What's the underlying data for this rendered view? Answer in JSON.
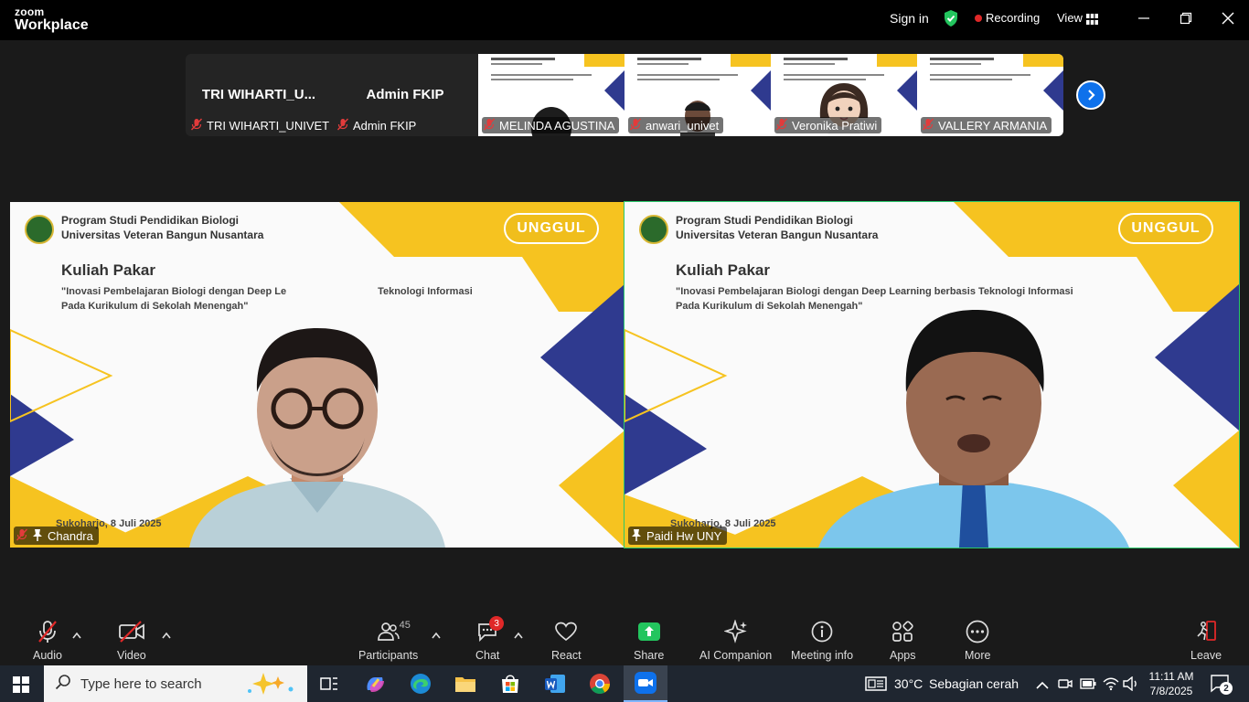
{
  "titlebar": {
    "logo_top": "zoom",
    "logo_bottom": "Workplace",
    "sign_in": "Sign in",
    "recording": "Recording",
    "view": "View"
  },
  "thumbnails": [
    {
      "big_name": "TRI WIHARTI_U...",
      "label": "TRI WIHARTI_UNIVET"
    },
    {
      "big_name": "Admin FKIP",
      "label": "Admin FKIP"
    },
    {
      "label": "MELINDA AGUSTINA"
    },
    {
      "label": "anwari_univet"
    },
    {
      "label": "Veronika Pratiwi"
    },
    {
      "label": "VALLERY ARMANIA"
    }
  ],
  "slide": {
    "header_line1": "Program Studi Pendidikan Biologi",
    "header_line2": "Universitas Veteran Bangun Nusantara",
    "badge": "UNGGUL",
    "kuliah": "Kuliah Pakar",
    "left_title_1": "\"Inovasi Pembelajaran Biologi dengan Deep Le",
    "left_title_1b": "Teknologi Informasi",
    "right_title_1": "\"Inovasi Pembelajaran Biologi dengan Deep Learning berbasis Teknologi Informasi",
    "title_2": "Pada Kurikulum di Sekolah Menengah\"",
    "date": "Sukoharjo, 8 Juli 2025"
  },
  "tiles": {
    "left_name": "Chandra",
    "right_name": "Paidi Hw UNY"
  },
  "toolbar": {
    "audio": "Audio",
    "video": "Video",
    "participants": "Participants",
    "participants_count": "45",
    "chat": "Chat",
    "chat_badge": "3",
    "react": "React",
    "share": "Share",
    "ai_companion": "AI Companion",
    "meeting_info": "Meeting info",
    "apps": "Apps",
    "more": "More",
    "leave": "Leave"
  },
  "taskbar": {
    "search_placeholder": "Type here to search",
    "temperature": "30°C",
    "weather": "Sebagian cerah",
    "time": "11:11 AM",
    "date": "7/8/2025",
    "notifications": "2"
  },
  "colors": {
    "zoom_blue": "#0e71eb",
    "active_speaker": "#2ac96b",
    "slide_yellow": "#f6c320",
    "slide_navy": "#2f3a8f",
    "recording_red": "#e02828"
  }
}
